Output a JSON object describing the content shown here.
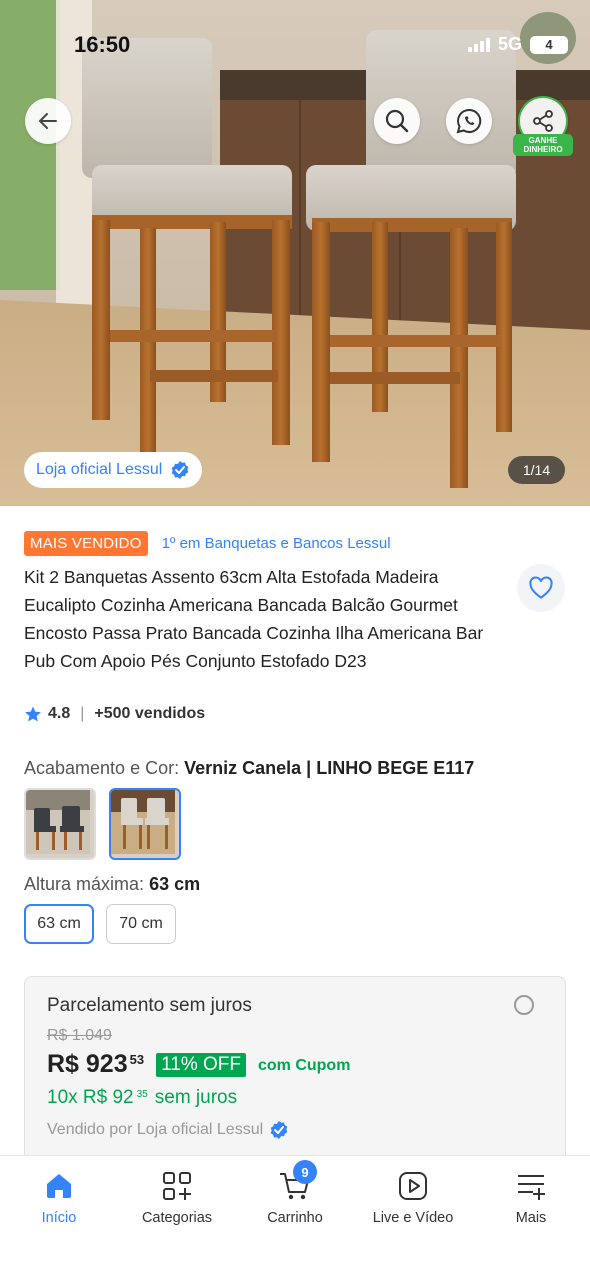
{
  "status_bar": {
    "time": "16:50",
    "network": "5G",
    "battery": "4"
  },
  "top_actions": {
    "earn_badge": "GANHE\nDINHEIRO"
  },
  "gallery": {
    "store_label": "Loja oficial Lessul",
    "counter": "1/14"
  },
  "product": {
    "badge": "MAIS VENDIDO",
    "ranking": "1º em Banquetas e Bancos Lessul",
    "title": "Kit 2 Banquetas Assento 63cm Alta Estofada Madeira Eucalipto Cozinha Americana Bancada Balcão Gourmet Encosto Passa Prato Bancada Cozinha Ilha Americana Bar Pub Com Apoio Pés Conjunto Estofado D23",
    "rating": "4.8",
    "sold": "+500 vendidos"
  },
  "variants": {
    "label": "Acabamento e Cor:",
    "selected": "Verniz Canela | LINHO BEGE E117",
    "height_label": "Altura máxima:",
    "height_selected": "63 cm",
    "sizes": [
      "63 cm",
      "70 cm"
    ]
  },
  "payment": {
    "title": "Parcelamento sem juros",
    "old_price": "R$ 1.049",
    "price": "R$ 923",
    "price_cents": "53",
    "discount": "11% OFF",
    "coupon": "com Cupom",
    "installment_prefix": "10x R$ 92",
    "installment_cents": "35",
    "installment_suffix": "sem juros",
    "seller": "Vendido por Loja oficial Lessul"
  },
  "nav": {
    "items": [
      {
        "label": "Início",
        "icon": "home-icon"
      },
      {
        "label": "Categorias",
        "icon": "categories-icon"
      },
      {
        "label": "Carrinho",
        "icon": "cart-icon"
      },
      {
        "label": "Live e Vídeo",
        "icon": "play-icon"
      },
      {
        "label": "Mais",
        "icon": "menu-plus-icon"
      }
    ],
    "cart_count": "9"
  },
  "colors": {
    "accent": "#3483fa",
    "best_seller": "#ff7733",
    "discount": "#00a650",
    "share_ring": "#39b54a"
  }
}
